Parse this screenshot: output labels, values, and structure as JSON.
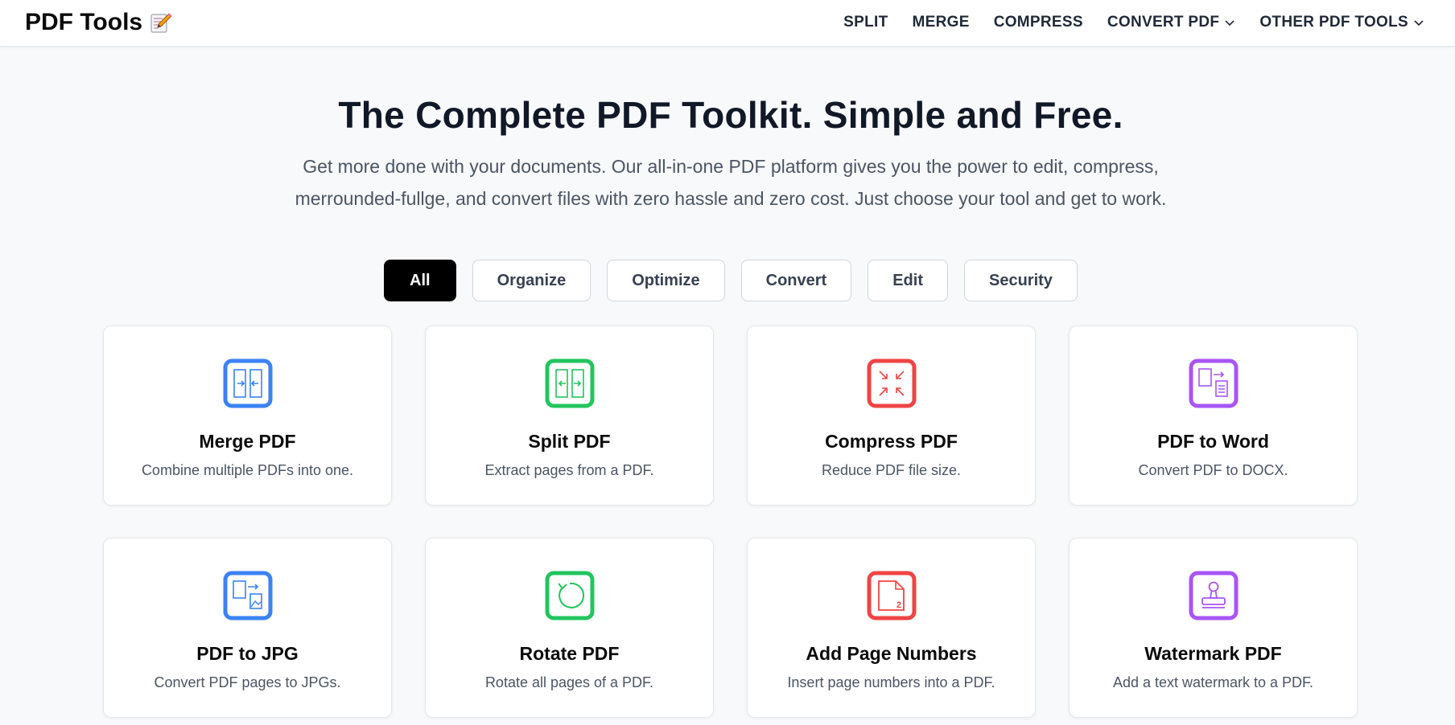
{
  "header": {
    "logo_text": "PDF Tools",
    "logo_icon": "memo-pencil-icon",
    "nav": [
      {
        "label": "SPLIT",
        "dropdown": false
      },
      {
        "label": "MERGE",
        "dropdown": false
      },
      {
        "label": "COMPRESS",
        "dropdown": false
      },
      {
        "label": "CONVERT PDF",
        "dropdown": true
      },
      {
        "label": "OTHER PDF TOOLS",
        "dropdown": true
      }
    ]
  },
  "hero": {
    "title": "The Complete PDF Toolkit. Simple and Free.",
    "subtitle_line1": "Get more done with your documents. Our all-in-one PDF platform gives you the power to edit, compress,",
    "subtitle_line2": "merrounded-fullge, and convert files with zero hassle and zero cost. Just choose your tool and get to work."
  },
  "filters": {
    "active": "All",
    "items": [
      "All",
      "Organize",
      "Optimize",
      "Convert",
      "Edit",
      "Security"
    ]
  },
  "colors": {
    "blue": "#3b82f6",
    "green": "#22c55e",
    "red": "#ef4444",
    "purple": "#a855f7"
  },
  "tools": [
    {
      "title": "Merge PDF",
      "desc": "Combine multiple PDFs into one.",
      "icon": "merge-icon",
      "color": "#3b82f6"
    },
    {
      "title": "Split PDF",
      "desc": "Extract pages from a PDF.",
      "icon": "split-icon",
      "color": "#22c55e"
    },
    {
      "title": "Compress PDF",
      "desc": "Reduce PDF file size.",
      "icon": "compress-icon",
      "color": "#ef4444"
    },
    {
      "title": "PDF to Word",
      "desc": "Convert PDF to DOCX.",
      "icon": "pdf-to-word-icon",
      "color": "#a855f7"
    },
    {
      "title": "PDF to JPG",
      "desc": "Convert PDF pages to JPGs.",
      "icon": "pdf-to-jpg-icon",
      "color": "#3b82f6"
    },
    {
      "title": "Rotate PDF",
      "desc": "Rotate all pages of a PDF.",
      "icon": "rotate-icon",
      "color": "#22c55e"
    },
    {
      "title": "Add Page Numbers",
      "desc": "Insert page numbers into a PDF.",
      "icon": "page-numbers-icon",
      "color": "#ef4444",
      "icon_number": "2"
    },
    {
      "title": "Watermark PDF",
      "desc": "Add a text watermark to a PDF.",
      "icon": "watermark-stamp-icon",
      "color": "#a855f7"
    }
  ]
}
